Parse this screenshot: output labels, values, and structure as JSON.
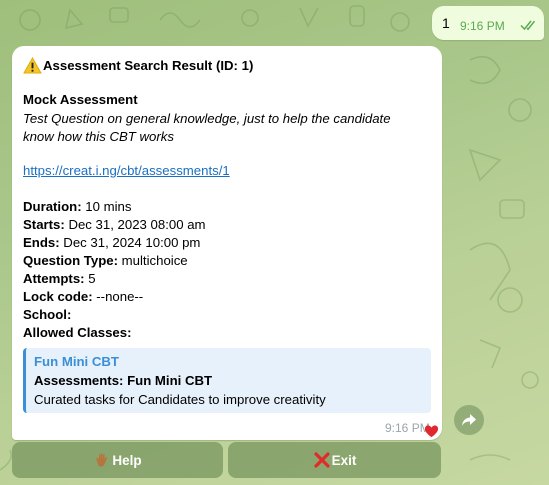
{
  "outgoing": {
    "text": "1",
    "time": "9:16 PM"
  },
  "message": {
    "title": "Assessment Search Result (ID: 1)",
    "name": "Mock Assessment",
    "description": "Test Question on general knowledge, just to help the candidate know how this CBT works",
    "link": "https://creat.i.ng/cbt/assessments/1",
    "fields": [
      {
        "label": "Duration:",
        "value": " 10 mins"
      },
      {
        "label": "Starts:",
        "value": " Dec 31, 2023 08:00 am"
      },
      {
        "label": "Ends:",
        "value": " Dec 31, 2024 10:00 pm"
      },
      {
        "label": "Question Type:",
        "value": " multichoice"
      },
      {
        "label": "Attempts:",
        "value": " 5"
      },
      {
        "label": "Lock code:",
        "value": " --none--"
      },
      {
        "label": "School:",
        "value": ""
      },
      {
        "label": "Allowed Classes:",
        "value": ""
      }
    ],
    "card": {
      "title": "Fun Mini CBT",
      "line2": "Assessments: Fun Mini CBT",
      "line3": "Curated tasks for Candidates to improve creativity"
    },
    "time": "9:16 PM"
  },
  "keyboard": {
    "help": "Help",
    "exit": "Exit"
  },
  "icons": {
    "warning": "warning-icon",
    "heart": "heart-icon",
    "share": "share-icon",
    "hand": "waving-hand-icon",
    "cross": "cross-icon",
    "read": "double-check-icon"
  },
  "colors": {
    "link": "#1a6fc2",
    "card_accent": "#3a8fd6",
    "outgoing_bg": "#effdde"
  }
}
